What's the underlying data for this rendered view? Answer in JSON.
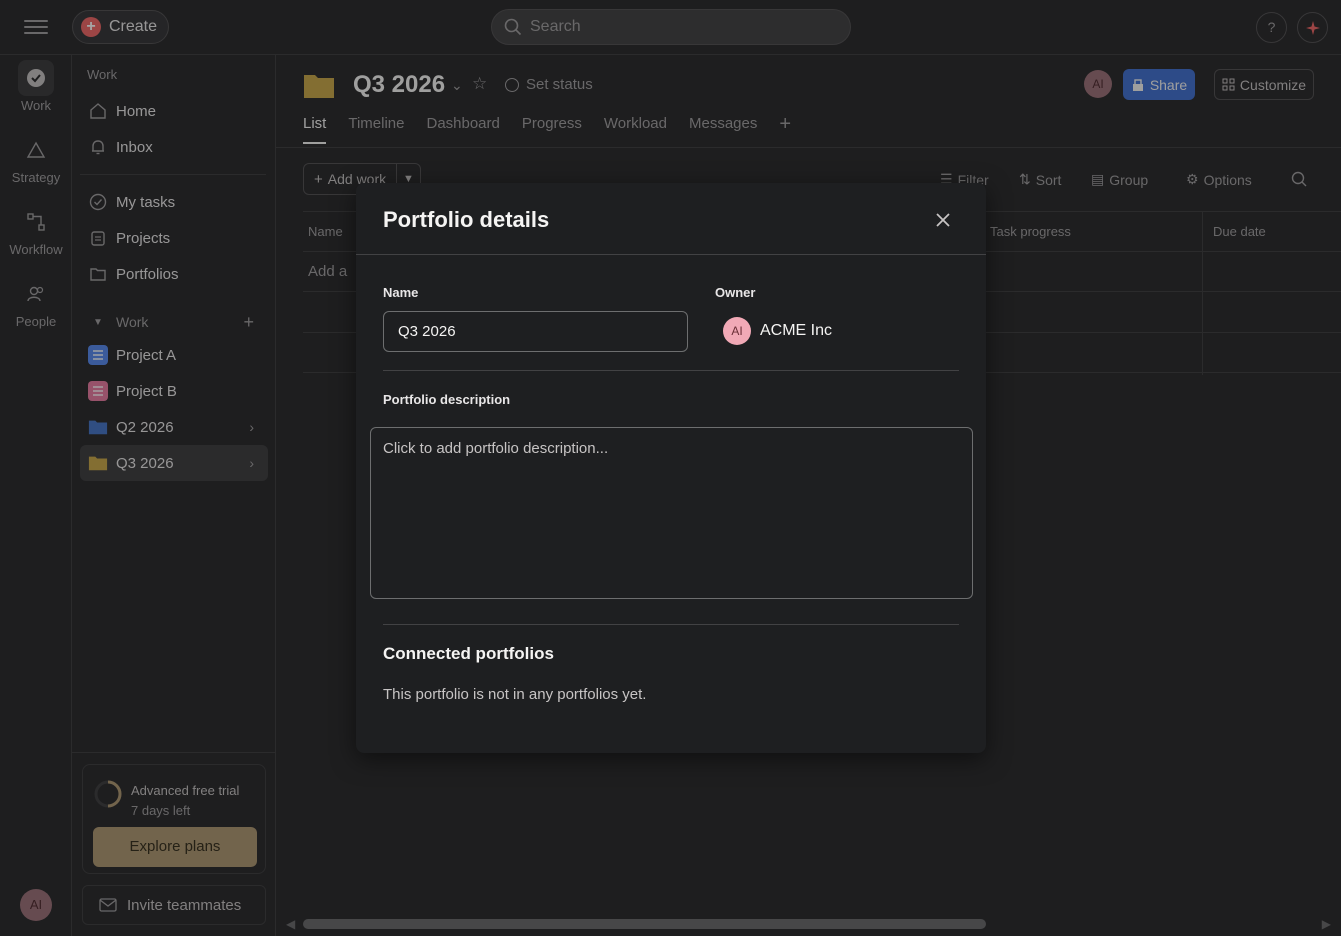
{
  "topbar": {
    "create_label": "Create",
    "search_placeholder": "Search",
    "help_label": "?"
  },
  "rail": {
    "items": [
      {
        "label": "Work",
        "icon": "check-circle-icon",
        "active": true
      },
      {
        "label": "Strategy",
        "icon": "triangle-icon",
        "active": false
      },
      {
        "label": "Workflow",
        "icon": "workflow-icon",
        "active": false
      },
      {
        "label": "People",
        "icon": "people-icon",
        "active": false
      }
    ],
    "avatar_initials": "AI"
  },
  "sidebar": {
    "section_label": "Work",
    "nav": [
      {
        "label": "Home",
        "icon": "home-icon"
      },
      {
        "label": "Inbox",
        "icon": "bell-icon"
      }
    ],
    "personal": [
      {
        "label": "My tasks",
        "icon": "check-circle-icon"
      },
      {
        "label": "Projects",
        "icon": "clipboard-icon"
      },
      {
        "label": "Portfolios",
        "icon": "folder-icon"
      }
    ],
    "work_group_label": "Work",
    "work_items": [
      {
        "label": "Project A",
        "icon": "list-icon",
        "color": "#5b8def"
      },
      {
        "label": "Project B",
        "icon": "list-icon",
        "color": "#e87ea4"
      },
      {
        "label": "Q2 2026",
        "icon": "folder-icon",
        "color": "#4a78c8"
      },
      {
        "label": "Q3 2026",
        "icon": "folder-icon",
        "color": "#c9a94e"
      }
    ],
    "trial_title": "Advanced free trial",
    "trial_sub": "7 days left",
    "explore_label": "Explore plans",
    "invite_label": "Invite teammates"
  },
  "header": {
    "title": "Q3 2026",
    "set_status": "Set status",
    "avatar_initials": "AI",
    "share_label": "Share",
    "customize_label": "Customize",
    "tabs": [
      "List",
      "Timeline",
      "Dashboard",
      "Progress",
      "Workload",
      "Messages"
    ],
    "active_tab": "List"
  },
  "toolbar": {
    "add_work": "Add work",
    "filter": "Filter",
    "sort": "Sort",
    "group": "Group",
    "options": "Options"
  },
  "table": {
    "columns": [
      "Name",
      "Task progress",
      "Due date"
    ],
    "add_row_placeholder": "Add a"
  },
  "modal": {
    "title": "Portfolio details",
    "name_label": "Name",
    "name_value": "Q3 2026",
    "owner_label": "Owner",
    "owner_initials": "AI",
    "owner_name": "ACME Inc",
    "description_label": "Portfolio description",
    "description_placeholder": "Click to add portfolio description...",
    "connected_title": "Connected portfolios",
    "connected_text": "This portfolio is not in any portfolios yet."
  },
  "colors": {
    "accent": "#4573d2",
    "create": "#f06a6a",
    "folder": "#c9a94e",
    "explore": "#b09a76"
  }
}
